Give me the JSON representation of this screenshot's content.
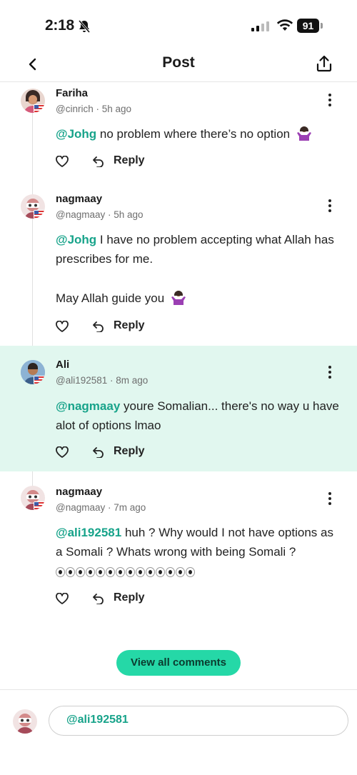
{
  "status_bar": {
    "time": "2:18",
    "battery": "91"
  },
  "navbar": {
    "title": "Post"
  },
  "comments": [
    {
      "username": "Fariha",
      "meta": "@cinrich · 5h ago",
      "mention": "@Johg",
      "text": " no problem where there’s no option",
      "reply_label": "Reply"
    },
    {
      "username": "nagmaay",
      "meta": "@nagmaay · 5h ago",
      "mention": "@Johg",
      "text": " I have no problem accepting what Allah has prescribes for me.",
      "text2": "May Allah guide you",
      "reply_label": "Reply"
    },
    {
      "username": "Ali",
      "meta": "@ali192581 · 8m ago",
      "mention": "@nagmaay",
      "text": " youre Somalian... there's no way u have alot of options lmao",
      "reply_label": "Reply"
    },
    {
      "username": "nagmaay",
      "meta": "@nagmaay · 7m ago",
      "mention": "@ali192581",
      "text": " huh ? Why would I not have options as a Somali ? Whats wrong with being Somali ?",
      "reply_label": "Reply"
    }
  ],
  "view_all_label": "View all comments",
  "composer": {
    "value": "@ali192581"
  },
  "colors": {
    "accent": "#17a38a",
    "button": "#25d8a7",
    "highlight": "#e1f7ef"
  },
  "icons": [
    "bell-slash-icon",
    "signal-icon",
    "wifi-icon",
    "battery-icon",
    "back-chevron-icon",
    "share-icon",
    "kebab-menu-icon",
    "heart-icon",
    "reply-arrow-icon",
    "shrug-emoji-icon",
    "eyes-emoji-icon"
  ]
}
